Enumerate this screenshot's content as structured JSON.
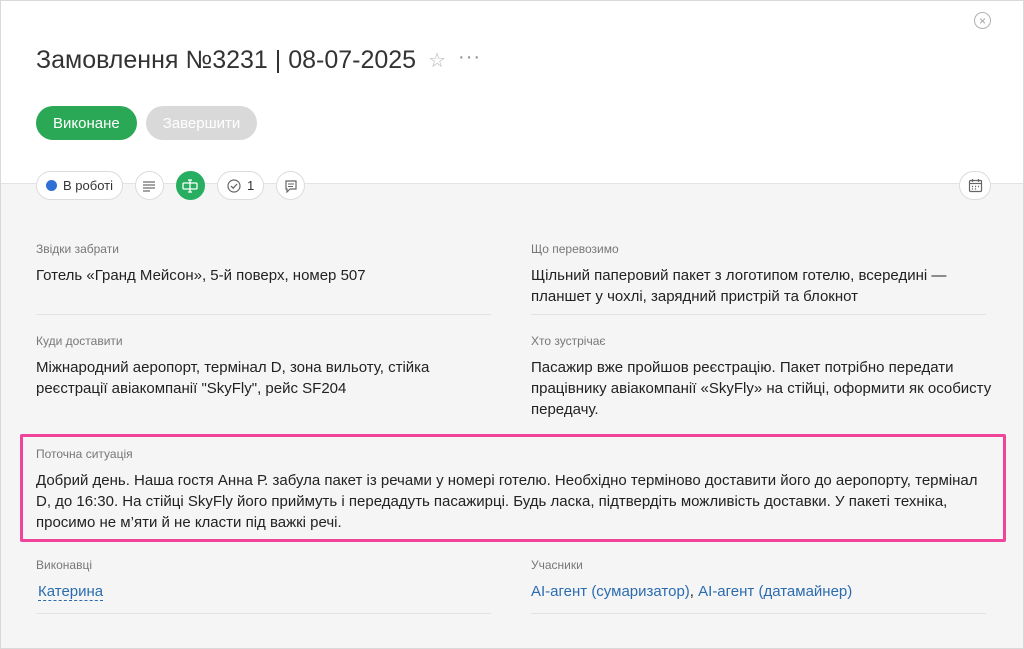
{
  "order": {
    "title": "Замовлення №3231 | 08-07-2025"
  },
  "actions": {
    "done_label": "Виконане",
    "finish_label": "Завершити"
  },
  "toolbar": {
    "status_label": "В роботі",
    "checklist_count": "1"
  },
  "fields": {
    "pickup": {
      "label": "Звідки забрати",
      "value": "Готель «Гранд Мейсон», 5-й поверх, номер 507"
    },
    "cargo": {
      "label": "Що перевозимо",
      "value_line1": "Щільний паперовий пакет з логотипом готелю, всередині —",
      "value_line2": "планшет у чохлі, зарядний пристрій та блокнот"
    },
    "delivery": {
      "label": "Куди доставити",
      "value_line1": "Міжнародний аеропорт, термінал D, зона вильоту, стійка",
      "value_line2": "реєстрації авіакомпанії \"SkyFly\", рейс SF204"
    },
    "receiver": {
      "label": "Хто зустрічає",
      "value_line1": "Пасажир вже пройшов реєстрацію. Пакет потрібно передати",
      "value_line2": "працівнику авіакомпанії «SkyFly» на стійці, оформити як особисту",
      "value_line3": "передачу."
    },
    "situation": {
      "label": "Поточна ситуація",
      "value_line1": "Добрий день. Наша гостя Анна Р. забула пакет із речами у номері готелю. Необхідно терміново доставити його до аеропорту, термінал",
      "value_line2": "D, до 16:30. На стійці SkyFly його приймуть і передадуть пасажирці. Будь ласка, підтвердіть можливість доставки. У пакеті техніка,",
      "value_line3": "просимо не м’яти й не класти під важкі речі."
    },
    "assignees": {
      "label": "Виконавці",
      "value": "Катерина"
    },
    "participants": {
      "label": "Учасники",
      "agent1": "AI-агент (сумаризатор)",
      "separator": ", ",
      "agent2": "AI-агент (датамайнер)"
    }
  },
  "colors": {
    "accent_green": "#2aa855",
    "status_blue": "#2f6fd6",
    "highlight_pink": "#f0439a",
    "link_blue": "#2b6cb0"
  }
}
